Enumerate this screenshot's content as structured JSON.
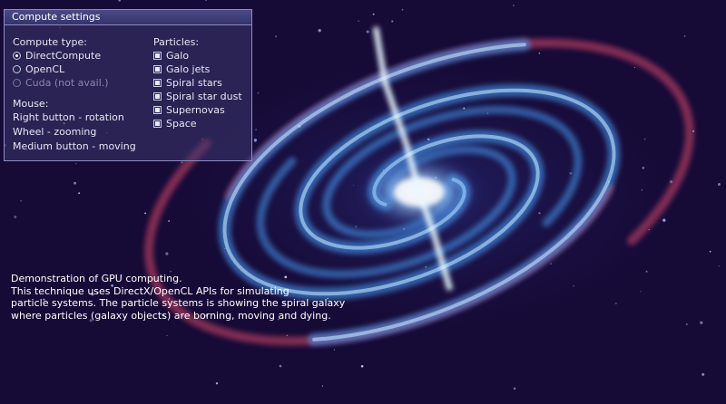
{
  "panel": {
    "title": "Compute settings",
    "compute_type": {
      "header": "Compute type:",
      "options": [
        {
          "label": "DirectCompute",
          "selected": true,
          "enabled": true
        },
        {
          "label": "OpenCL",
          "selected": false,
          "enabled": true
        },
        {
          "label": "Cuda (not avail.)",
          "selected": false,
          "enabled": false
        }
      ]
    },
    "mouse": {
      "header": "Mouse:",
      "lines": [
        "Right button - rotation",
        "Wheel - zooming",
        "Medium button - moving"
      ]
    },
    "particles": {
      "header": "Particles:",
      "items": [
        {
          "label": "Galo",
          "checked": true
        },
        {
          "label": "Galo jets",
          "checked": true
        },
        {
          "label": "Spiral stars",
          "checked": true
        },
        {
          "label": "Spiral star dust",
          "checked": true
        },
        {
          "label": "Supernovas",
          "checked": true
        },
        {
          "label": "Space",
          "checked": true
        }
      ]
    }
  },
  "description": {
    "lines": [
      "Demonstration of GPU computing.",
      "This technique uses DirectX/OpenCL APIs for simulating",
      "particle systems. The particle systems is showing the spiral galaxy",
      "where particles (galaxy objects) are borning, moving and dying."
    ]
  },
  "colors": {
    "background": "#160a36",
    "arm_blue": "#4aa6ff",
    "arm_red": "#d84a6a",
    "core": "#e8f6ff"
  }
}
